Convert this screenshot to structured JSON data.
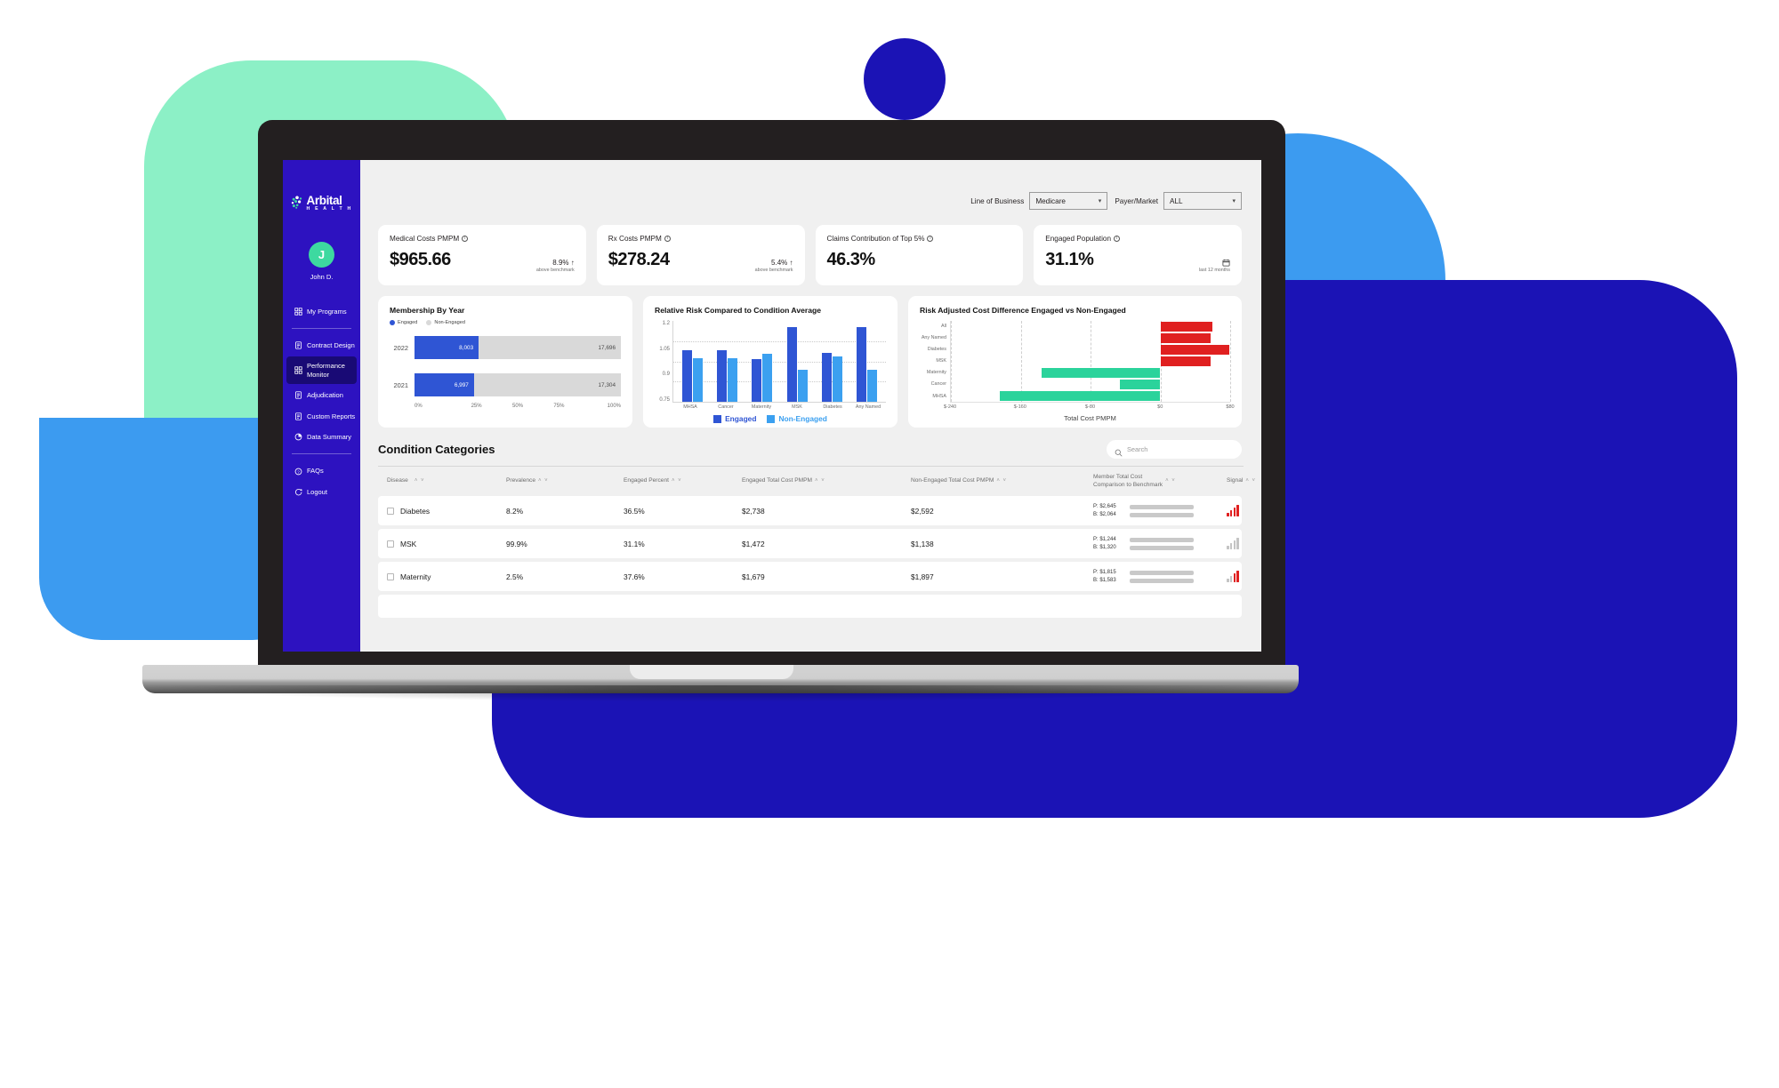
{
  "colors": {
    "brand_navy": "#2D12C0",
    "brand_navy_dark": "#190A75",
    "mint": "#8CF0C6",
    "teal": "#3DD9A0",
    "light_blue": "#3C9BF0",
    "deep_blue": "#1B13B5",
    "bar_blue": "#2F55D4",
    "chart_blue_dark": "#2F55D4",
    "chart_blue_light": "#3BA0F0",
    "chart_green": "#2BD39B",
    "chart_red": "#E02020",
    "track_grey": "#D9D9D9",
    "screen_bg": "#F0F0F0",
    "bezel": "#231F20"
  },
  "brand": {
    "name": "Arbital",
    "sub": "H E A L T H",
    "logo_icon": "arbital-dots-logo"
  },
  "user": {
    "initial": "J",
    "name": "John D."
  },
  "sidebar": {
    "items": [
      {
        "label": "My Programs",
        "icon": "grid-icon",
        "active": false,
        "after_divider": true
      },
      {
        "label": "Contract Design",
        "icon": "document-icon",
        "active": false
      },
      {
        "label": "Performance Monitor",
        "icon": "grid-icon",
        "active": true
      },
      {
        "label": "Adjudication",
        "icon": "document-icon",
        "active": false
      },
      {
        "label": "Custom Reports",
        "icon": "document-icon",
        "active": false
      },
      {
        "label": "Data Summary",
        "icon": "pie-clock-icon",
        "active": false,
        "after_divider": true
      },
      {
        "label": "FAQs",
        "icon": "question-circle-icon",
        "active": false
      },
      {
        "label": "Logout",
        "icon": "logout-icon",
        "active": false
      }
    ]
  },
  "topbar": {
    "filters": [
      {
        "label": "Line of Business",
        "value": "Medicare"
      },
      {
        "label": "Payer/Market",
        "value": "ALL"
      }
    ]
  },
  "kpis": [
    {
      "title": "Medical Costs PMPM",
      "value": "$965.66",
      "delta": "8.9% ↑",
      "note": "above benchmark",
      "icon": "info-icon"
    },
    {
      "title": "Rx Costs PMPM",
      "value": "$278.24",
      "delta": "5.4% ↑",
      "note": "above benchmark",
      "icon": "info-icon"
    },
    {
      "title": "Claims Contribution of Top 5%",
      "value": "46.3%",
      "delta": "",
      "note": "",
      "icon": "info-icon"
    },
    {
      "title": "Engaged Population",
      "value": "31.1%",
      "delta": "",
      "note": "last 12 months",
      "icon": "info-icon",
      "right_icon": "calendar-icon"
    }
  ],
  "chart_data": [
    {
      "type": "bar",
      "orientation": "horizontal",
      "title": "Membership By Year",
      "categories": [
        "2022",
        "2021"
      ],
      "legend": [
        "Engaged",
        "Non-Engaged"
      ],
      "legend_position": "top-left",
      "series": [
        {
          "name": "Engaged",
          "values": [
            8003,
            6997
          ],
          "labels": [
            "8,003",
            "6,997"
          ],
          "color": "#2F55D4"
        },
        {
          "name": "Non-Engaged",
          "values": [
            17696,
            17304
          ],
          "labels": [
            "17,696",
            "17,304"
          ],
          "color": "#D9D9D9"
        }
      ],
      "engaged_pct": [
        31.1,
        28.8
      ],
      "xlabel": "",
      "ylabel": "",
      "xticks": [
        "0%",
        "25%",
        "50%",
        "75%",
        "100%"
      ],
      "grid": false
    },
    {
      "type": "bar",
      "orientation": "vertical",
      "title": "Relative Risk Compared to Condition Average",
      "categories": [
        "MHSA",
        "Cancer",
        "Maternity",
        "MSK",
        "Diabetes",
        "Any Named"
      ],
      "series": [
        {
          "name": "Engaged",
          "values": [
            1.035,
            1.035,
            0.985,
            1.16,
            1.02,
            1.16
          ],
          "color": "#2F55D4"
        },
        {
          "name": "Non-Engaged",
          "values": [
            0.99,
            0.99,
            1.015,
            0.925,
            1.0,
            0.925
          ],
          "color": "#3BA0F0"
        }
      ],
      "ylim": [
        0.75,
        1.2
      ],
      "yticks": [
        "1.2",
        "1.05",
        "0.9",
        "0.75"
      ],
      "legend": [
        "Engaged",
        "Non-Engaged"
      ],
      "legend_position": "bottom",
      "grid": true
    },
    {
      "type": "bar",
      "orientation": "horizontal",
      "title": "Risk Adjusted Cost Difference Engaged vs Non-Engaged",
      "categories": [
        "All",
        "Any Named",
        "Diabetes",
        "MSK",
        "Maternity",
        "Cancer",
        "MHSA"
      ],
      "values": [
        60,
        58,
        79,
        58,
        -136,
        -46,
        -184
      ],
      "colors": [
        "#E02020",
        "#E02020",
        "#E02020",
        "#E02020",
        "#2BD39B",
        "#2BD39B",
        "#2BD39B"
      ],
      "xlabel": "Total Cost PMPM",
      "xticks": [
        "$-240",
        "$-160",
        "$-80",
        "$0",
        "$80"
      ],
      "xlim": [
        -240,
        80
      ],
      "grid": true
    }
  ],
  "table": {
    "section_title": "Condition Categories",
    "search": {
      "placeholder": "Search",
      "value": "",
      "icon": "search-icon"
    },
    "sort_glyph": "˄ ˅",
    "columns": [
      {
        "label": "Disease",
        "sortable": true
      },
      {
        "label": "Prevalence",
        "sortable": true
      },
      {
        "label": "Engaged Percent",
        "sortable": true
      },
      {
        "label": "Engaged Total Cost PMPM",
        "sortable": true
      },
      {
        "label": "Non-Engaged Total Cost PMPM",
        "sortable": true
      },
      {
        "label": "Member Total Cost Comparison to Benchmark",
        "sortable": true
      },
      {
        "label": "Signal",
        "sortable": true
      }
    ],
    "rows": [
      {
        "disease": "Diabetes",
        "prevalence": "8.2%",
        "engaged_percent": "36.5%",
        "engaged_total_cost": "$2,738",
        "non_engaged_total_cost": "$2,592",
        "benchmark": {
          "p_label": "P: $2,645",
          "p_pct": 61,
          "p_color": "#2F55D4",
          "b_label": "B: $2,064",
          "b_pct": 44,
          "b_color": "#2BD39B"
        },
        "signal": {
          "color": "#E02020",
          "bars": [
            4,
            7,
            10,
            13
          ],
          "level": "high"
        }
      },
      {
        "disease": "MSK",
        "prevalence": "99.9%",
        "engaged_percent": "31.1%",
        "engaged_total_cost": "$1,472",
        "non_engaged_total_cost": "$1,138",
        "benchmark": {
          "p_label": "P: $1,244",
          "p_pct": 25,
          "p_color": "#2F55D4",
          "b_label": "B: $1,320",
          "b_pct": 25,
          "b_color": "#2BD39B"
        },
        "signal": {
          "color": "#C4C4C4",
          "bars": [
            4,
            7,
            10,
            13
          ],
          "level": "none"
        }
      },
      {
        "disease": "Maternity",
        "prevalence": "2.5%",
        "engaged_percent": "37.6%",
        "engaged_total_cost": "$1,679",
        "non_engaged_total_cost": "$1,897",
        "benchmark": {
          "p_label": "P: $1,815",
          "p_pct": 34,
          "p_color": "#2F55D4",
          "b_label": "B: $1,583",
          "b_pct": 28,
          "b_color": "#2BD39B"
        },
        "signal": {
          "color": "#E02020",
          "bars": [
            4,
            7,
            10,
            13
          ],
          "level": "low"
        }
      }
    ]
  }
}
